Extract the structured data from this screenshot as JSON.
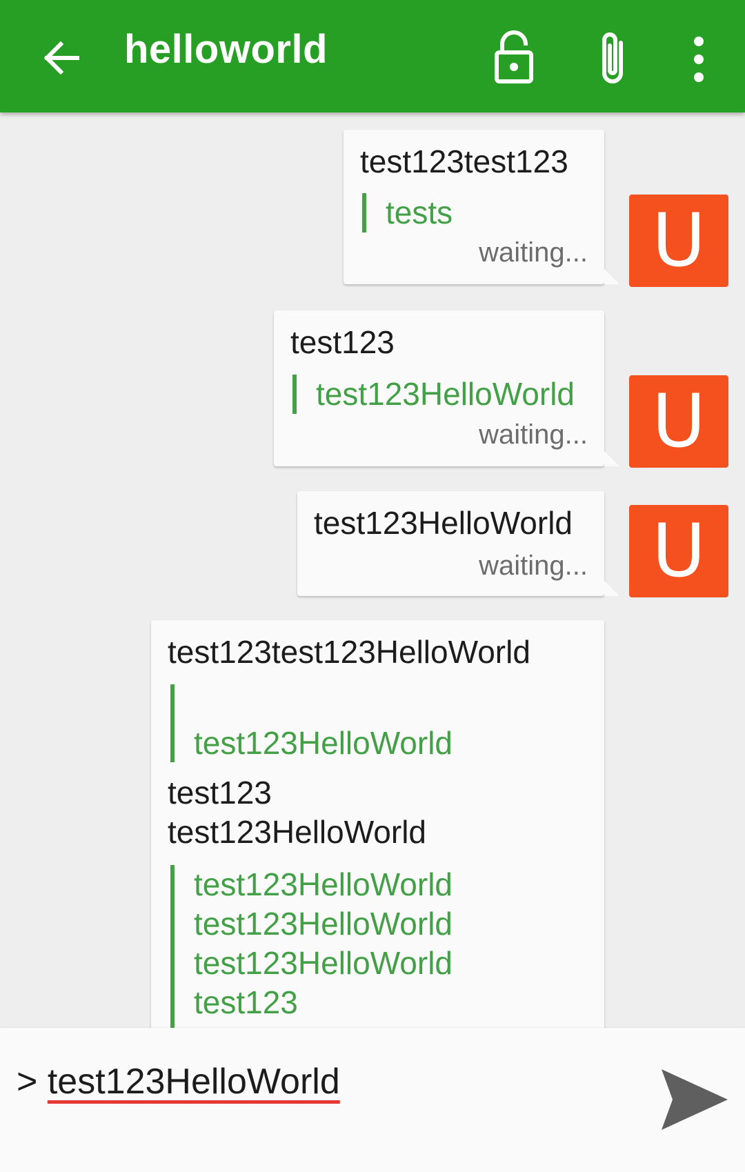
{
  "appbar": {
    "title": "helloworld",
    "back_icon": "arrow-left-icon",
    "lock_icon": "lock-open-icon",
    "attach_icon": "paperclip-icon",
    "more_icon": "more-vertical-icon",
    "color": "#279e24"
  },
  "messages": [
    {
      "text": "test123test123",
      "quote": "tests",
      "status": "waiting...",
      "avatar": "U"
    },
    {
      "text": "test123",
      "quote": "test123HelloWorld",
      "status": "waiting...",
      "avatar": "U"
    },
    {
      "text": "test123HelloWorld",
      "status": "waiting...",
      "avatar": "U"
    },
    {
      "text": "test123test123HelloWorld",
      "quote1": "test123HelloWorld",
      "body1": "test123",
      "body2": "test123HelloWorld",
      "quote2_lines": [
        "test123HelloWorld",
        "test123HelloWorld",
        "test123HelloWorld",
        "test123"
      ]
    }
  ],
  "composer": {
    "prefix": ">",
    "value": "test123HelloWorld",
    "send_icon": "send-icon"
  },
  "colors": {
    "avatar": "#f4511e",
    "quote": "#43a047",
    "spellcheck": "#e53935"
  }
}
